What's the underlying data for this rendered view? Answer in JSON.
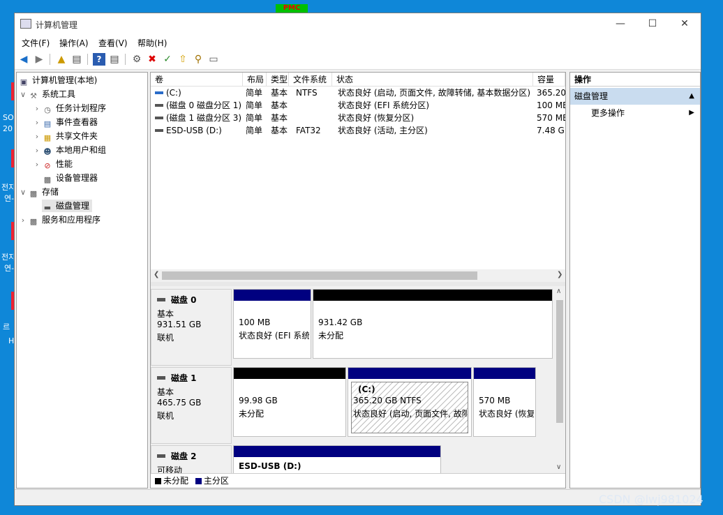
{
  "desktop": {
    "top_icon_text": "PMC",
    "glyphs": [
      "SO",
      "20",
      "전지",
      "연-",
      "전지",
      "연-",
      "르",
      "H"
    ]
  },
  "window": {
    "title": "计算机管理",
    "controls": {
      "minimize": "—",
      "maximize": "☐",
      "close": "✕"
    }
  },
  "menu": [
    "文件(F)",
    "操作(A)",
    "查看(V)",
    "帮助(H)"
  ],
  "tree": {
    "root": "计算机管理(本地)",
    "system_tools": "系统工具",
    "task_scheduler": "任务计划程序",
    "event_viewer": "事件查看器",
    "shared_folders": "共享文件夹",
    "local_users": "本地用户和组",
    "performance": "性能",
    "device_manager": "设备管理器",
    "storage": "存储",
    "disk_management": "磁盘管理",
    "services_apps": "服务和应用程序"
  },
  "volume_table": {
    "headers": [
      "卷",
      "布局",
      "类型",
      "文件系统",
      "状态",
      "容量"
    ],
    "rows": [
      [
        "(C:)",
        "简单",
        "基本",
        "NTFS",
        "状态良好 (启动, 页面文件, 故障转储, 基本数据分区)",
        "365.20"
      ],
      [
        "(磁盘 0 磁盘分区 1)",
        "简单",
        "基本",
        "",
        "状态良好 (EFI 系统分区)",
        "100 MB"
      ],
      [
        "(磁盘 1 磁盘分区 3)",
        "简单",
        "基本",
        "",
        "状态良好 (恢复分区)",
        "570 MB"
      ],
      [
        "ESD-USB (D:)",
        "简单",
        "基本",
        "FAT32",
        "状态良好 (活动, 主分区)",
        "7.48 GB"
      ]
    ]
  },
  "disks": [
    {
      "name": "磁盘 0",
      "type": "基本",
      "size": "931.51 GB",
      "status": "联机",
      "partitions": [
        {
          "kind": "primary",
          "label": "",
          "line1": "100 MB",
          "line2": "状态良好 (EFI 系统"
        },
        {
          "kind": "unallocated",
          "label": "",
          "line1": "931.42 GB",
          "line2": "未分配"
        }
      ]
    },
    {
      "name": "磁盘 1",
      "type": "基本",
      "size": "465.75 GB",
      "status": "联机",
      "partitions": [
        {
          "kind": "unallocated",
          "label": "",
          "line1": "99.98 GB",
          "line2": "未分配"
        },
        {
          "kind": "primary",
          "label": "(C:)",
          "line1": "365.20 GB NTFS",
          "line2": "状态良好 (启动, 页面文件, 故障"
        },
        {
          "kind": "primary",
          "label": "",
          "line1": "570 MB",
          "line2": "状态良好 (恢复"
        }
      ]
    },
    {
      "name": "磁盘 2",
      "type": "可移动",
      "size": "",
      "status": "",
      "partitions": [
        {
          "kind": "primary",
          "label": "ESD-USB  (D:)",
          "line1": "",
          "line2": ""
        }
      ]
    }
  ],
  "legend": {
    "unallocated": "未分配",
    "primary": "主分区"
  },
  "colors": {
    "unallocated": "#000000",
    "primary": "#000080",
    "selection": "#c9dcef"
  },
  "actions": {
    "header": "操作",
    "section": "磁盘管理",
    "more": "更多操作"
  },
  "watermark": "CSDN @lwj981024"
}
